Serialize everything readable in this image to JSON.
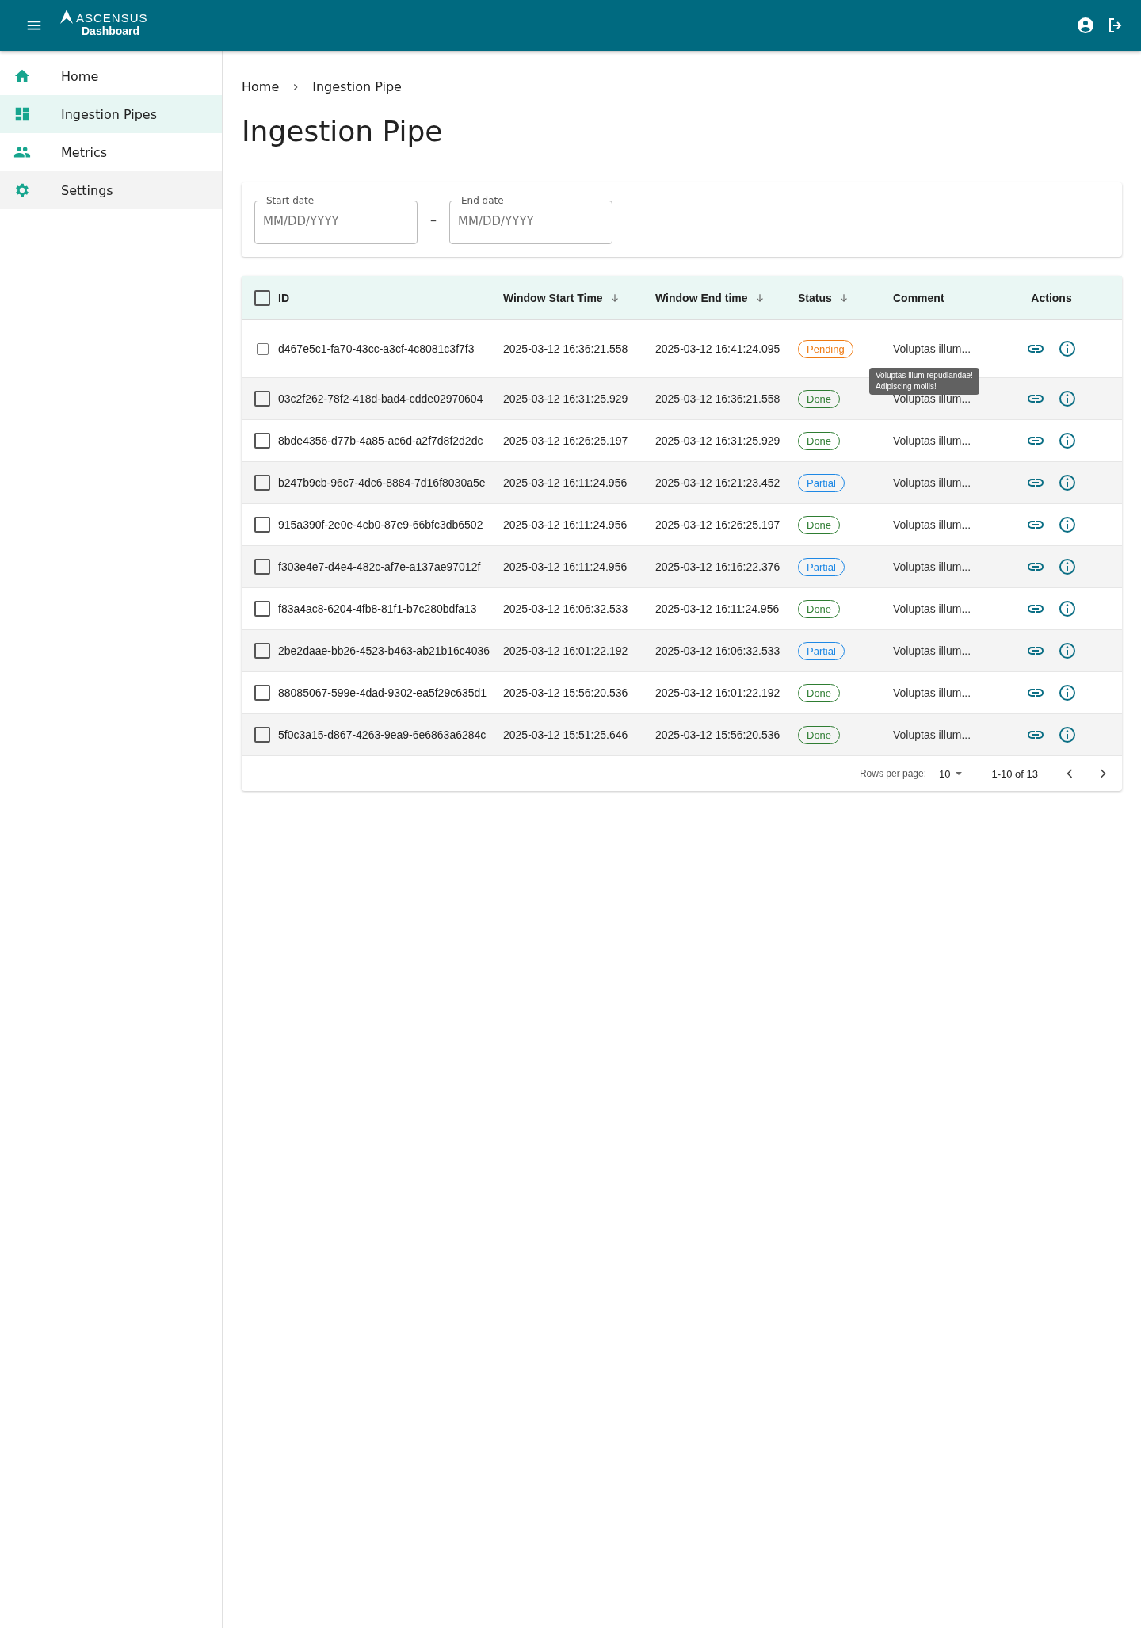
{
  "header": {
    "brand": "ASCENSUS",
    "subtitle": "Dashboard"
  },
  "sidebar": {
    "items": [
      {
        "label": "Home",
        "selected": false,
        "hovered": false
      },
      {
        "label": "Ingestion Pipes",
        "selected": true,
        "hovered": false
      },
      {
        "label": "Metrics",
        "selected": false,
        "hovered": false
      },
      {
        "label": "Settings",
        "selected": false,
        "hovered": true
      }
    ]
  },
  "breadcrumb": [
    "Home",
    "Ingestion Pipe"
  ],
  "title": "Ingestion Pipe",
  "filters": {
    "start": {
      "label": "Start date",
      "placeholder": "MM/DD/YYYY"
    },
    "separator": "–",
    "end": {
      "label": "End date",
      "placeholder": "MM/DD/YYYY"
    }
  },
  "table": {
    "select_all_checked": false,
    "columns": [
      {
        "label": "ID",
        "sorted": false
      },
      {
        "label": "Window Start Time",
        "sorted": true
      },
      {
        "label": "Window End time",
        "sorted": true
      },
      {
        "label": "Status",
        "sorted": true
      },
      {
        "label": "Comment",
        "sorted": false
      },
      {
        "label": "Actions",
        "sorted": false
      }
    ],
    "rows": [
      {
        "checked": false,
        "id": "d467e5c1-fa70-43cc-a3cf-4c8081c3f7f3",
        "start": "2025-03-12 16:36:21.558",
        "end": "2025-03-12 16:41:24.095",
        "status": "Pending",
        "kind": "pending",
        "comment": "Voluptas illum...",
        "tooltip": [
          "Voluptas illum repudiandae!",
          "Adipiscing mollis!"
        ]
      },
      {
        "checked": false,
        "id": "03c2f262-78f2-418d-bad4-cdde02970604",
        "start": "2025-03-12 16:31:25.929",
        "end": "2025-03-12 16:36:21.558",
        "status": "Done",
        "kind": "done",
        "comment": "Voluptas illum..."
      },
      {
        "checked": false,
        "id": "8bde4356-d77b-4a85-ac6d-a2f7d8f2d2dc",
        "start": "2025-03-12 16:26:25.197",
        "end": "2025-03-12 16:31:25.929",
        "status": "Done",
        "kind": "done",
        "comment": "Voluptas illum..."
      },
      {
        "checked": false,
        "id": "b247b9cb-96c7-4dc6-8884-7d16f8030a5e",
        "start": "2025-03-12 16:11:24.956",
        "end": "2025-03-12 16:21:23.452",
        "status": "Partial",
        "kind": "partial",
        "comment": "Voluptas illum..."
      },
      {
        "checked": false,
        "id": "915a390f-2e0e-4cb0-87e9-66bfc3db6502",
        "start": "2025-03-12 16:11:24.956",
        "end": "2025-03-12 16:26:25.197",
        "status": "Done",
        "kind": "done",
        "comment": "Voluptas illum..."
      },
      {
        "checked": false,
        "id": "f303e4e7-d4e4-482c-af7e-a137ae97012f",
        "start": "2025-03-12 16:11:24.956",
        "end": "2025-03-12 16:16:22.376",
        "status": "Partial",
        "kind": "partial",
        "comment": "Voluptas illum..."
      },
      {
        "checked": false,
        "id": "f83a4ac8-6204-4fb8-81f1-b7c280bdfa13",
        "start": "2025-03-12 16:06:32.533",
        "end": "2025-03-12 16:11:24.956",
        "status": "Done",
        "kind": "done",
        "comment": "Voluptas illum..."
      },
      {
        "checked": false,
        "id": "2be2daae-bb26-4523-b463-ab21b16c4036",
        "start": "2025-03-12 16:01:22.192",
        "end": "2025-03-12 16:06:32.533",
        "status": "Partial",
        "kind": "partial",
        "comment": "Voluptas illum..."
      },
      {
        "checked": false,
        "id": "88085067-599e-4dad-9302-ea5f29c635d1",
        "start": "2025-03-12 15:56:20.536",
        "end": "2025-03-12 16:01:22.192",
        "status": "Done",
        "kind": "done",
        "comment": "Voluptas illum..."
      },
      {
        "checked": false,
        "id": "5f0c3a15-d867-4263-9ea9-6e6863a6284c",
        "start": "2025-03-12 15:51:25.646",
        "end": "2025-03-12 15:56:20.536",
        "status": "Done",
        "kind": "done",
        "comment": "Voluptas illum..."
      }
    ]
  },
  "pagination": {
    "rows_label": "Rows per page:",
    "rows_value": "10",
    "range": "1-10 of 13"
  }
}
